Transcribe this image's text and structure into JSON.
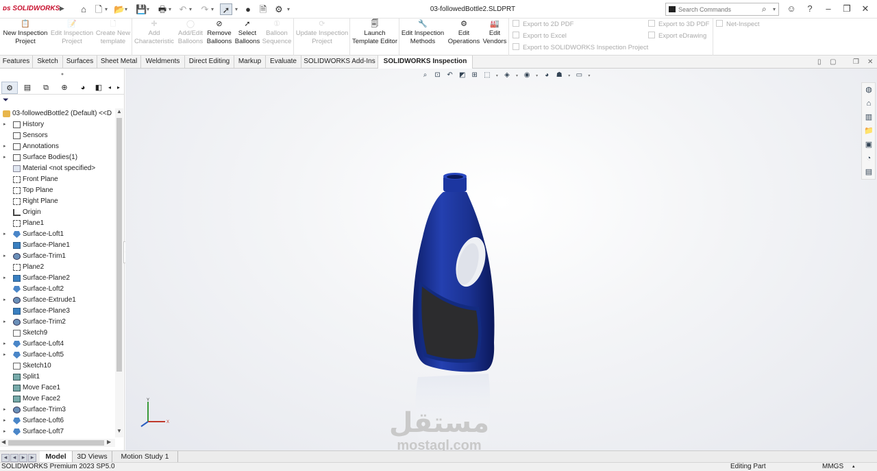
{
  "app": {
    "logo": "SOLIDWORKS",
    "document_title": "03-followedBottle2.SLDPRT"
  },
  "search": {
    "placeholder": "Search Commands"
  },
  "command_manager": {
    "buttons": [
      {
        "label": "New Inspection Project",
        "enabled": true,
        "icon": "new-inspection-icon"
      },
      {
        "label": "Edit Inspection Project",
        "enabled": false,
        "icon": "edit-inspection-icon"
      },
      {
        "label": "Create New template",
        "enabled": false,
        "icon": "new-template-icon"
      },
      {
        "label": "Add Characteristic",
        "enabled": false,
        "icon": "add-characteristic-icon"
      },
      {
        "label": "Add/Edit Balloons",
        "enabled": false,
        "icon": "balloon-icon"
      },
      {
        "label": "Remove Balloons",
        "enabled": true,
        "icon": "remove-balloon-icon"
      },
      {
        "label": "Select Balloons",
        "enabled": true,
        "icon": "select-balloon-icon"
      },
      {
        "label": "Balloon Sequence",
        "enabled": false,
        "icon": "balloon-sequence-icon"
      },
      {
        "label": "Update Inspection Project",
        "enabled": false,
        "icon": "update-icon"
      },
      {
        "label": "Launch Template Editor",
        "enabled": true,
        "icon": "template-editor-icon"
      },
      {
        "label": "Edit Inspection Methods",
        "enabled": true,
        "icon": "methods-icon"
      },
      {
        "label": "Edit Operations",
        "enabled": true,
        "icon": "operations-icon"
      },
      {
        "label": "Edit Vendors",
        "enabled": true,
        "icon": "vendors-icon"
      }
    ],
    "export_col1": [
      "Export to 2D PDF",
      "Export to Excel",
      "Export to SOLIDWORKS Inspection Project"
    ],
    "export_col2": [
      "Export to 3D PDF",
      "Export eDrawing"
    ],
    "net_inspect": "Net-Inspect"
  },
  "tabs": [
    "Features",
    "Sketch",
    "Surfaces",
    "Sheet Metal",
    "Weldments",
    "Direct Editing",
    "Markup",
    "Evaluate",
    "SOLIDWORKS Add-Ins",
    "SOLIDWORKS Inspection"
  ],
  "active_tab": "SOLIDWORKS Inspection",
  "feature_tree": {
    "root": "03-followedBottle2 (Default) <<D",
    "items": [
      {
        "label": "History",
        "icon": "folder",
        "expandable": true
      },
      {
        "label": "Sensors",
        "icon": "folder",
        "expandable": false
      },
      {
        "label": "Annotations",
        "icon": "folder",
        "expandable": true
      },
      {
        "label": "Surface Bodies(1)",
        "icon": "folder",
        "expandable": true
      },
      {
        "label": "Material <not specified>",
        "icon": "mat",
        "expandable": false
      },
      {
        "label": "Front Plane",
        "icon": "plane",
        "expandable": false
      },
      {
        "label": "Top Plane",
        "icon": "plane",
        "expandable": false
      },
      {
        "label": "Right Plane",
        "icon": "plane",
        "expandable": false
      },
      {
        "label": "Origin",
        "icon": "origin",
        "expandable": false
      },
      {
        "label": "Plane1",
        "icon": "plane",
        "expandable": false
      },
      {
        "label": "Surface-Loft1",
        "icon": "loft",
        "expandable": true
      },
      {
        "label": "Surface-Plane1",
        "icon": "surface",
        "expandable": false
      },
      {
        "label": "Surface-Trim1",
        "icon": "trim",
        "expandable": true
      },
      {
        "label": "Plane2",
        "icon": "plane",
        "expandable": false
      },
      {
        "label": "Surface-Plane2",
        "icon": "surface",
        "expandable": true
      },
      {
        "label": "Surface-Loft2",
        "icon": "loft",
        "expandable": false
      },
      {
        "label": "Surface-Extrude1",
        "icon": "trim",
        "expandable": true
      },
      {
        "label": "Surface-Plane3",
        "icon": "surface",
        "expandable": false
      },
      {
        "label": "Surface-Trim2",
        "icon": "trim",
        "expandable": true
      },
      {
        "label": "Sketch9",
        "icon": "sketch",
        "expandable": false
      },
      {
        "label": "Surface-Loft4",
        "icon": "loft",
        "expandable": true
      },
      {
        "label": "Surface-Loft5",
        "icon": "loft",
        "expandable": true
      },
      {
        "label": "Sketch10",
        "icon": "sketch",
        "expandable": false
      },
      {
        "label": "Split1",
        "icon": "split",
        "expandable": false
      },
      {
        "label": "Move Face1",
        "icon": "split",
        "expandable": false
      },
      {
        "label": "Move Face2",
        "icon": "split",
        "expandable": false
      },
      {
        "label": "Surface-Trim3",
        "icon": "trim",
        "expandable": true
      },
      {
        "label": "Surface-Loft6",
        "icon": "loft",
        "expandable": true
      },
      {
        "label": "Surface-Loft7",
        "icon": "loft",
        "expandable": true
      }
    ]
  },
  "bottom_tabs": [
    "Model",
    "3D Views",
    "Motion Study 1"
  ],
  "active_bottom_tab": "Model",
  "status_bar": {
    "product": "SOLIDWORKS Premium 2023 SP5.0",
    "mode": "Editing Part",
    "units": "MMGS"
  },
  "triad": {
    "x": "X",
    "y": "Y"
  },
  "watermark": {
    "arabic": "مستقل",
    "latin": "mostaql.com"
  },
  "colors": {
    "bottle_body": "#1f3a9a",
    "label_panel": "#2b2b2b",
    "logo_red": "#c8102e"
  }
}
